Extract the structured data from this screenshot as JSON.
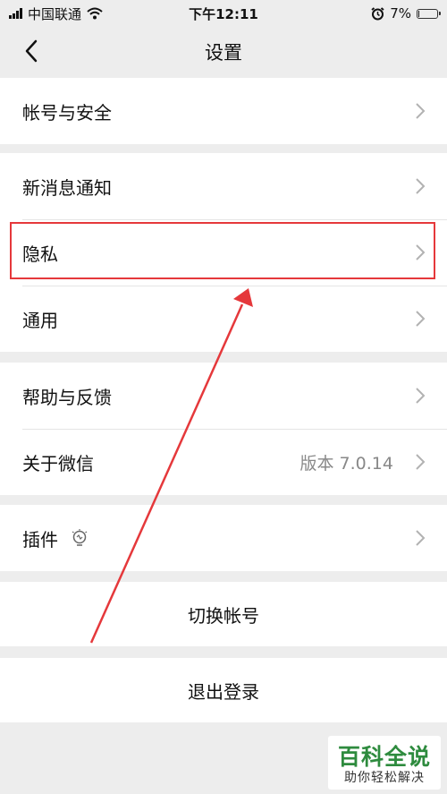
{
  "status_bar": {
    "carrier": "中国联通",
    "time": "下午12:11",
    "battery_percent": "7%",
    "battery_level": 0.07,
    "icons": [
      "signal-icon",
      "wifi-icon",
      "alarm-icon",
      "battery-icon"
    ]
  },
  "nav": {
    "title": "设置",
    "back_icon": "chevron-left-icon"
  },
  "groups": {
    "account": {
      "label": "帐号与安全"
    },
    "notify": {
      "label": "新消息通知"
    },
    "privacy": {
      "label": "隐私"
    },
    "general": {
      "label": "通用"
    },
    "help": {
      "label": "帮助与反馈"
    },
    "about": {
      "label": "关于微信",
      "value": "版本 7.0.14"
    },
    "plugins": {
      "label": "插件",
      "icon": "bulb-icon"
    }
  },
  "actions": {
    "switch_account": "切换帐号",
    "logout": "退出登录"
  },
  "annotation": {
    "highlight_color": "#e5383b",
    "arrow_color": "#e5383b"
  },
  "watermark": {
    "title": "百科全说",
    "subtitle": "助你轻松解决",
    "color": "#2e8b3e"
  }
}
